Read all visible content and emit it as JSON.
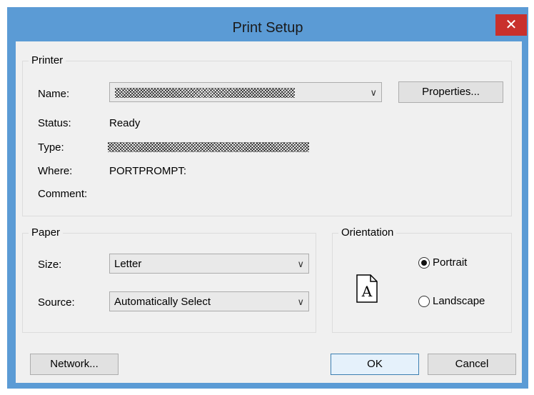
{
  "window": {
    "title": "Print Setup",
    "close_glyph": "✕"
  },
  "printer": {
    "group_label": "Printer",
    "name_label": "Name:",
    "status_label": "Status:",
    "status_value": "Ready",
    "type_label": "Type:",
    "where_label": "Where:",
    "where_value": "PORTPROMPT:",
    "comment_label": "Comment:",
    "properties_button": "Properties..."
  },
  "paper": {
    "group_label": "Paper",
    "size_label": "Size:",
    "size_value": "Letter",
    "source_label": "Source:",
    "source_value": "Automatically Select"
  },
  "orientation": {
    "group_label": "Orientation",
    "portrait_label": "Portrait",
    "landscape_label": "Landscape",
    "selected": "Portrait",
    "preview_letter": "A"
  },
  "buttons": {
    "network": "Network...",
    "ok": "OK",
    "cancel": "Cancel"
  },
  "colors": {
    "title_bar": "#5b9bd5",
    "close_button": "#c9302c",
    "client_background": "#f0f0f0"
  },
  "icons": {
    "dropdown": "chevron-down-icon",
    "close": "close-icon",
    "page": "portrait-page-icon"
  }
}
